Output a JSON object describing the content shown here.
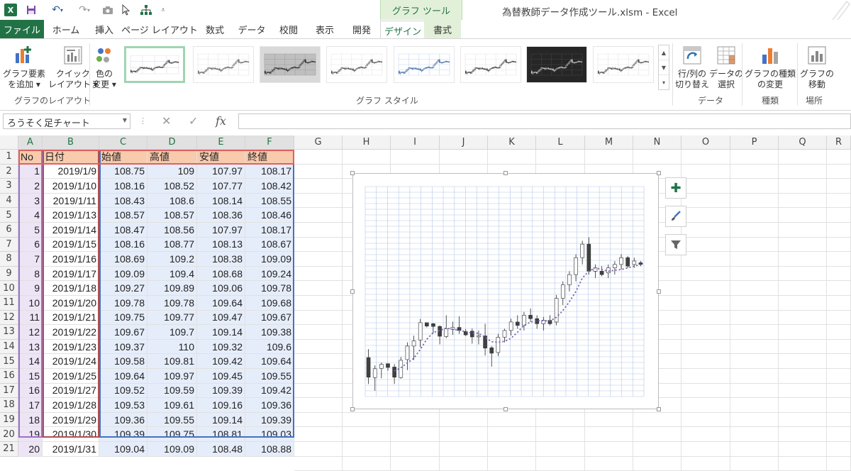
{
  "titlebar": {
    "title": "為替教師データ作成ツール.xlsm - Excel",
    "contextual_tab_group": "グラフ ツール",
    "excel_icon_text": "X"
  },
  "tabs": [
    "ファイル",
    "ホーム",
    "挿入",
    "ページ レイアウト",
    "数式",
    "データ",
    "校閲",
    "表示",
    "開発",
    "デザイン",
    "書式"
  ],
  "ribbon": {
    "add_chart_element": "グラフ要素\nを追加 ▾",
    "quick_layout": "クイック\nレイアウト ▾",
    "change_colors": "色の\n変更 ▾",
    "group_layout": "グラフのレイアウト",
    "group_styles": "グラフ スタイル",
    "switch_row_col": "行/列の\n切り替え",
    "select_data": "データの\n選択",
    "group_data": "データ",
    "change_type": "グラフの種類\nの変更",
    "group_type": "種類",
    "move_chart": "グラフの\n移動",
    "group_location": "場所"
  },
  "formula_bar": {
    "name_box": "ろうそく足チャート",
    "formula": ""
  },
  "columns": [
    "A",
    "B",
    "C",
    "D",
    "E",
    "F",
    "G",
    "H",
    "I",
    "J",
    "K",
    "L",
    "M",
    "N",
    "O",
    "P",
    "Q",
    "R"
  ],
  "rows": [
    "1",
    "2",
    "3",
    "4",
    "5",
    "6",
    "7",
    "8",
    "9",
    "10",
    "11",
    "12",
    "13",
    "14",
    "15",
    "16",
    "17",
    "18",
    "19",
    "20",
    "21"
  ],
  "table": {
    "headers": [
      "No",
      "日付",
      "始値",
      "高値",
      "安値",
      "終値"
    ],
    "data": [
      [
        "1",
        "2019/1/9",
        "108.75",
        "109",
        "107.97",
        "108.17"
      ],
      [
        "2",
        "2019/1/10",
        "108.16",
        "108.52",
        "107.77",
        "108.42"
      ],
      [
        "3",
        "2019/1/11",
        "108.43",
        "108.6",
        "108.14",
        "108.55"
      ],
      [
        "4",
        "2019/1/13",
        "108.57",
        "108.57",
        "108.36",
        "108.46"
      ],
      [
        "5",
        "2019/1/14",
        "108.47",
        "108.56",
        "107.97",
        "108.17"
      ],
      [
        "6",
        "2019/1/15",
        "108.16",
        "108.77",
        "108.13",
        "108.67"
      ],
      [
        "7",
        "2019/1/16",
        "108.69",
        "109.2",
        "108.38",
        "109.09"
      ],
      [
        "8",
        "2019/1/17",
        "109.09",
        "109.4",
        "108.68",
        "109.24"
      ],
      [
        "9",
        "2019/1/18",
        "109.27",
        "109.89",
        "109.06",
        "109.78"
      ],
      [
        "10",
        "2019/1/20",
        "109.78",
        "109.78",
        "109.64",
        "109.68"
      ],
      [
        "11",
        "2019/1/21",
        "109.75",
        "109.77",
        "109.47",
        "109.67"
      ],
      [
        "12",
        "2019/1/22",
        "109.67",
        "109.7",
        "109.14",
        "109.38"
      ],
      [
        "13",
        "2019/1/23",
        "109.37",
        "110",
        "109.32",
        "109.6"
      ],
      [
        "14",
        "2019/1/24",
        "109.58",
        "109.81",
        "109.42",
        "109.64"
      ],
      [
        "15",
        "2019/1/25",
        "109.64",
        "109.97",
        "109.45",
        "109.55"
      ],
      [
        "16",
        "2019/1/27",
        "109.52",
        "109.59",
        "109.39",
        "109.42"
      ],
      [
        "17",
        "2019/1/28",
        "109.53",
        "109.61",
        "109.16",
        "109.36"
      ],
      [
        "18",
        "2019/1/29",
        "109.36",
        "109.55",
        "109.14",
        "109.39"
      ],
      [
        "19",
        "2019/1/30",
        "109.39",
        "109.75",
        "108.81",
        "109.03"
      ]
    ],
    "partial_row": [
      "20",
      "2019/1/31",
      "109.04",
      "109.09",
      "108.48",
      "108.88"
    ]
  },
  "chart_data": {
    "type": "candlestick",
    "candles": [
      [
        108.75,
        109.0,
        107.97,
        108.17
      ],
      [
        108.16,
        108.52,
        107.77,
        108.42
      ],
      [
        108.43,
        108.6,
        108.14,
        108.55
      ],
      [
        108.57,
        108.57,
        108.36,
        108.46
      ],
      [
        108.47,
        108.56,
        107.97,
        108.17
      ],
      [
        108.16,
        108.77,
        108.13,
        108.67
      ],
      [
        108.69,
        109.2,
        108.38,
        109.09
      ],
      [
        109.09,
        109.4,
        108.68,
        109.24
      ],
      [
        109.27,
        109.89,
        109.06,
        109.78
      ],
      [
        109.78,
        109.78,
        109.64,
        109.68
      ],
      [
        109.75,
        109.77,
        109.47,
        109.67
      ],
      [
        109.67,
        109.7,
        109.14,
        109.38
      ],
      [
        109.37,
        110.0,
        109.32,
        109.6
      ],
      [
        109.58,
        109.81,
        109.42,
        109.64
      ],
      [
        109.64,
        109.97,
        109.45,
        109.55
      ],
      [
        109.52,
        109.59,
        109.39,
        109.42
      ],
      [
        109.53,
        109.61,
        109.16,
        109.36
      ],
      [
        109.36,
        109.55,
        109.14,
        109.39
      ],
      [
        109.39,
        109.75,
        108.81,
        109.03
      ],
      [
        109.04,
        109.09,
        108.48,
        108.88
      ],
      [
        108.9,
        109.45,
        108.8,
        109.35
      ],
      [
        109.35,
        109.6,
        109.2,
        109.55
      ],
      [
        109.55,
        109.9,
        109.4,
        109.8
      ],
      [
        109.8,
        110.0,
        109.6,
        109.7
      ],
      [
        109.7,
        110.1,
        109.55,
        110.0
      ],
      [
        110.0,
        110.2,
        109.8,
        109.9
      ],
      [
        109.9,
        110.0,
        109.6,
        109.75
      ],
      [
        109.75,
        109.95,
        109.55,
        109.85
      ],
      [
        109.85,
        110.0,
        109.7,
        109.75
      ],
      [
        109.8,
        110.6,
        109.7,
        110.5
      ],
      [
        110.5,
        111.0,
        110.3,
        110.9
      ],
      [
        110.9,
        111.3,
        110.7,
        111.2
      ],
      [
        111.2,
        111.8,
        111.0,
        111.7
      ],
      [
        111.7,
        112.2,
        111.5,
        112.1
      ],
      [
        112.1,
        112.3,
        111.2,
        111.3
      ],
      [
        111.3,
        111.5,
        111.1,
        111.4
      ],
      [
        111.3,
        111.45,
        111.15,
        111.2
      ],
      [
        111.25,
        111.5,
        111.1,
        111.4
      ],
      [
        111.4,
        111.6,
        111.2,
        111.5
      ],
      [
        111.5,
        111.8,
        111.35,
        111.7
      ],
      [
        111.7,
        111.75,
        111.4,
        111.45
      ],
      [
        111.5,
        111.7,
        111.4,
        111.6
      ],
      [
        111.55,
        111.6,
        111.45,
        111.5
      ]
    ],
    "moving_average": [
      null,
      null,
      null,
      null,
      108.35,
      108.45,
      108.59,
      108.73,
      108.99,
      109.29,
      109.49,
      109.55,
      109.62,
      109.59,
      109.55,
      109.52,
      109.47,
      109.47,
      109.35,
      109.22,
      109.2,
      109.23,
      109.32,
      109.5,
      109.7,
      109.8,
      109.84,
      109.84,
      109.83,
      109.94,
      110.14,
      110.4,
      110.7,
      111.1,
      111.3,
      111.4,
      111.35,
      111.3,
      111.33,
      111.35,
      111.4,
      111.45,
      111.5
    ],
    "ylim": [
      107.6,
      113.8
    ],
    "grid": true,
    "colors": {
      "up": "#ffffff",
      "down": "#404040",
      "ma": "#7b62b0",
      "grid": "#b4c7e7"
    }
  },
  "colors": {
    "excel_green": "#217346",
    "header_fill": "#f8cbad",
    "ribbon_bg": "#ffffff"
  }
}
